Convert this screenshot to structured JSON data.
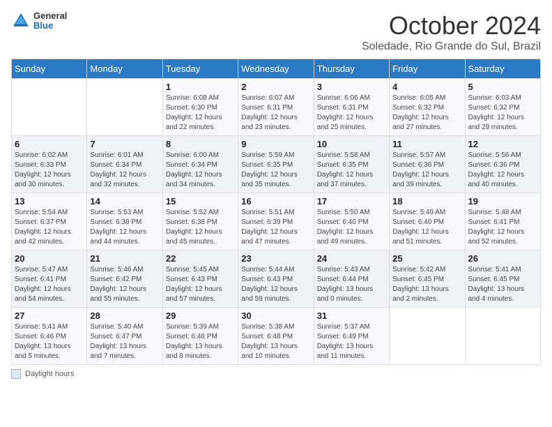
{
  "header": {
    "logo": {
      "general": "General",
      "blue": "Blue"
    },
    "title": "October 2024",
    "location": "Soledade, Rio Grande do Sul, Brazil"
  },
  "weekdays": [
    "Sunday",
    "Monday",
    "Tuesday",
    "Wednesday",
    "Thursday",
    "Friday",
    "Saturday"
  ],
  "weeks": [
    [
      {
        "day": "",
        "sunrise": "",
        "sunset": "",
        "daylight": ""
      },
      {
        "day": "",
        "sunrise": "",
        "sunset": "",
        "daylight": ""
      },
      {
        "day": "1",
        "sunrise": "Sunrise: 6:08 AM",
        "sunset": "Sunset: 6:30 PM",
        "daylight": "Daylight: 12 hours and 22 minutes."
      },
      {
        "day": "2",
        "sunrise": "Sunrise: 6:07 AM",
        "sunset": "Sunset: 6:31 PM",
        "daylight": "Daylight: 12 hours and 23 minutes."
      },
      {
        "day": "3",
        "sunrise": "Sunrise: 6:06 AM",
        "sunset": "Sunset: 6:31 PM",
        "daylight": "Daylight: 12 hours and 25 minutes."
      },
      {
        "day": "4",
        "sunrise": "Sunrise: 6:05 AM",
        "sunset": "Sunset: 6:32 PM",
        "daylight": "Daylight: 12 hours and 27 minutes."
      },
      {
        "day": "5",
        "sunrise": "Sunrise: 6:03 AM",
        "sunset": "Sunset: 6:32 PM",
        "daylight": "Daylight: 12 hours and 29 minutes."
      }
    ],
    [
      {
        "day": "6",
        "sunrise": "Sunrise: 6:02 AM",
        "sunset": "Sunset: 6:33 PM",
        "daylight": "Daylight: 12 hours and 30 minutes."
      },
      {
        "day": "7",
        "sunrise": "Sunrise: 6:01 AM",
        "sunset": "Sunset: 6:34 PM",
        "daylight": "Daylight: 12 hours and 32 minutes."
      },
      {
        "day": "8",
        "sunrise": "Sunrise: 6:00 AM",
        "sunset": "Sunset: 6:34 PM",
        "daylight": "Daylight: 12 hours and 34 minutes."
      },
      {
        "day": "9",
        "sunrise": "Sunrise: 5:59 AM",
        "sunset": "Sunset: 6:35 PM",
        "daylight": "Daylight: 12 hours and 35 minutes."
      },
      {
        "day": "10",
        "sunrise": "Sunrise: 5:58 AM",
        "sunset": "Sunset: 6:35 PM",
        "daylight": "Daylight: 12 hours and 37 minutes."
      },
      {
        "day": "11",
        "sunrise": "Sunrise: 5:57 AM",
        "sunset": "Sunset: 6:36 PM",
        "daylight": "Daylight: 12 hours and 39 minutes."
      },
      {
        "day": "12",
        "sunrise": "Sunrise: 5:56 AM",
        "sunset": "Sunset: 6:36 PM",
        "daylight": "Daylight: 12 hours and 40 minutes."
      }
    ],
    [
      {
        "day": "13",
        "sunrise": "Sunrise: 5:54 AM",
        "sunset": "Sunset: 6:37 PM",
        "daylight": "Daylight: 12 hours and 42 minutes."
      },
      {
        "day": "14",
        "sunrise": "Sunrise: 5:53 AM",
        "sunset": "Sunset: 6:38 PM",
        "daylight": "Daylight: 12 hours and 44 minutes."
      },
      {
        "day": "15",
        "sunrise": "Sunrise: 5:52 AM",
        "sunset": "Sunset: 6:38 PM",
        "daylight": "Daylight: 12 hours and 45 minutes."
      },
      {
        "day": "16",
        "sunrise": "Sunrise: 5:51 AM",
        "sunset": "Sunset: 6:39 PM",
        "daylight": "Daylight: 12 hours and 47 minutes."
      },
      {
        "day": "17",
        "sunrise": "Sunrise: 5:50 AM",
        "sunset": "Sunset: 6:40 PM",
        "daylight": "Daylight: 12 hours and 49 minutes."
      },
      {
        "day": "18",
        "sunrise": "Sunrise: 5:49 AM",
        "sunset": "Sunset: 6:40 PM",
        "daylight": "Daylight: 12 hours and 51 minutes."
      },
      {
        "day": "19",
        "sunrise": "Sunrise: 5:48 AM",
        "sunset": "Sunset: 6:41 PM",
        "daylight": "Daylight: 12 hours and 52 minutes."
      }
    ],
    [
      {
        "day": "20",
        "sunrise": "Sunrise: 5:47 AM",
        "sunset": "Sunset: 6:41 PM",
        "daylight": "Daylight: 12 hours and 54 minutes."
      },
      {
        "day": "21",
        "sunrise": "Sunrise: 5:46 AM",
        "sunset": "Sunset: 6:42 PM",
        "daylight": "Daylight: 12 hours and 55 minutes."
      },
      {
        "day": "22",
        "sunrise": "Sunrise: 5:45 AM",
        "sunset": "Sunset: 6:43 PM",
        "daylight": "Daylight: 12 hours and 57 minutes."
      },
      {
        "day": "23",
        "sunrise": "Sunrise: 5:44 AM",
        "sunset": "Sunset: 6:43 PM",
        "daylight": "Daylight: 12 hours and 59 minutes."
      },
      {
        "day": "24",
        "sunrise": "Sunrise: 5:43 AM",
        "sunset": "Sunset: 6:44 PM",
        "daylight": "Daylight: 13 hours and 0 minutes."
      },
      {
        "day": "25",
        "sunrise": "Sunrise: 5:42 AM",
        "sunset": "Sunset: 6:45 PM",
        "daylight": "Daylight: 13 hours and 2 minutes."
      },
      {
        "day": "26",
        "sunrise": "Sunrise: 5:41 AM",
        "sunset": "Sunset: 6:45 PM",
        "daylight": "Daylight: 13 hours and 4 minutes."
      }
    ],
    [
      {
        "day": "27",
        "sunrise": "Sunrise: 5:41 AM",
        "sunset": "Sunset: 6:46 PM",
        "daylight": "Daylight: 13 hours and 5 minutes."
      },
      {
        "day": "28",
        "sunrise": "Sunrise: 5:40 AM",
        "sunset": "Sunset: 6:47 PM",
        "daylight": "Daylight: 13 hours and 7 minutes."
      },
      {
        "day": "29",
        "sunrise": "Sunrise: 5:39 AM",
        "sunset": "Sunset: 6:48 PM",
        "daylight": "Daylight: 13 hours and 8 minutes."
      },
      {
        "day": "30",
        "sunrise": "Sunrise: 5:38 AM",
        "sunset": "Sunset: 6:48 PM",
        "daylight": "Daylight: 13 hours and 10 minutes."
      },
      {
        "day": "31",
        "sunrise": "Sunrise: 5:37 AM",
        "sunset": "Sunset: 6:49 PM",
        "daylight": "Daylight: 13 hours and 11 minutes."
      },
      {
        "day": "",
        "sunrise": "",
        "sunset": "",
        "daylight": ""
      },
      {
        "day": "",
        "sunrise": "",
        "sunset": "",
        "daylight": ""
      }
    ]
  ],
  "footer": {
    "label": "Daylight hours"
  }
}
